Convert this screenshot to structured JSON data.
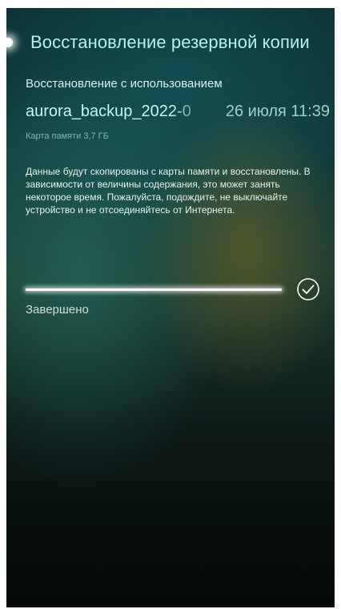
{
  "header": {
    "title": "Восстановление резервной копии"
  },
  "restore": {
    "using_label": "Восстановление с использованием",
    "backup": {
      "file_name": "aurora_backup_2022-0",
      "date": "26 июля 11:39",
      "storage": "Карта памяти 3,7 ГБ"
    },
    "description": "Данные будут скопированы с карты памяти и восстановлены. В зависимости от величины содержания, это может занять некоторое время. Пожалуйста, подождите, не выключайте устройство и не отсоединяйтесь от Интернета.",
    "progress": {
      "value": 1.0,
      "status": "Завершено"
    }
  },
  "icons": {
    "pulley": "pulley-menu-indicator",
    "done": "check-circle-icon"
  },
  "colors": {
    "accent": "#b6f2ea",
    "progress": "#ffffff"
  }
}
